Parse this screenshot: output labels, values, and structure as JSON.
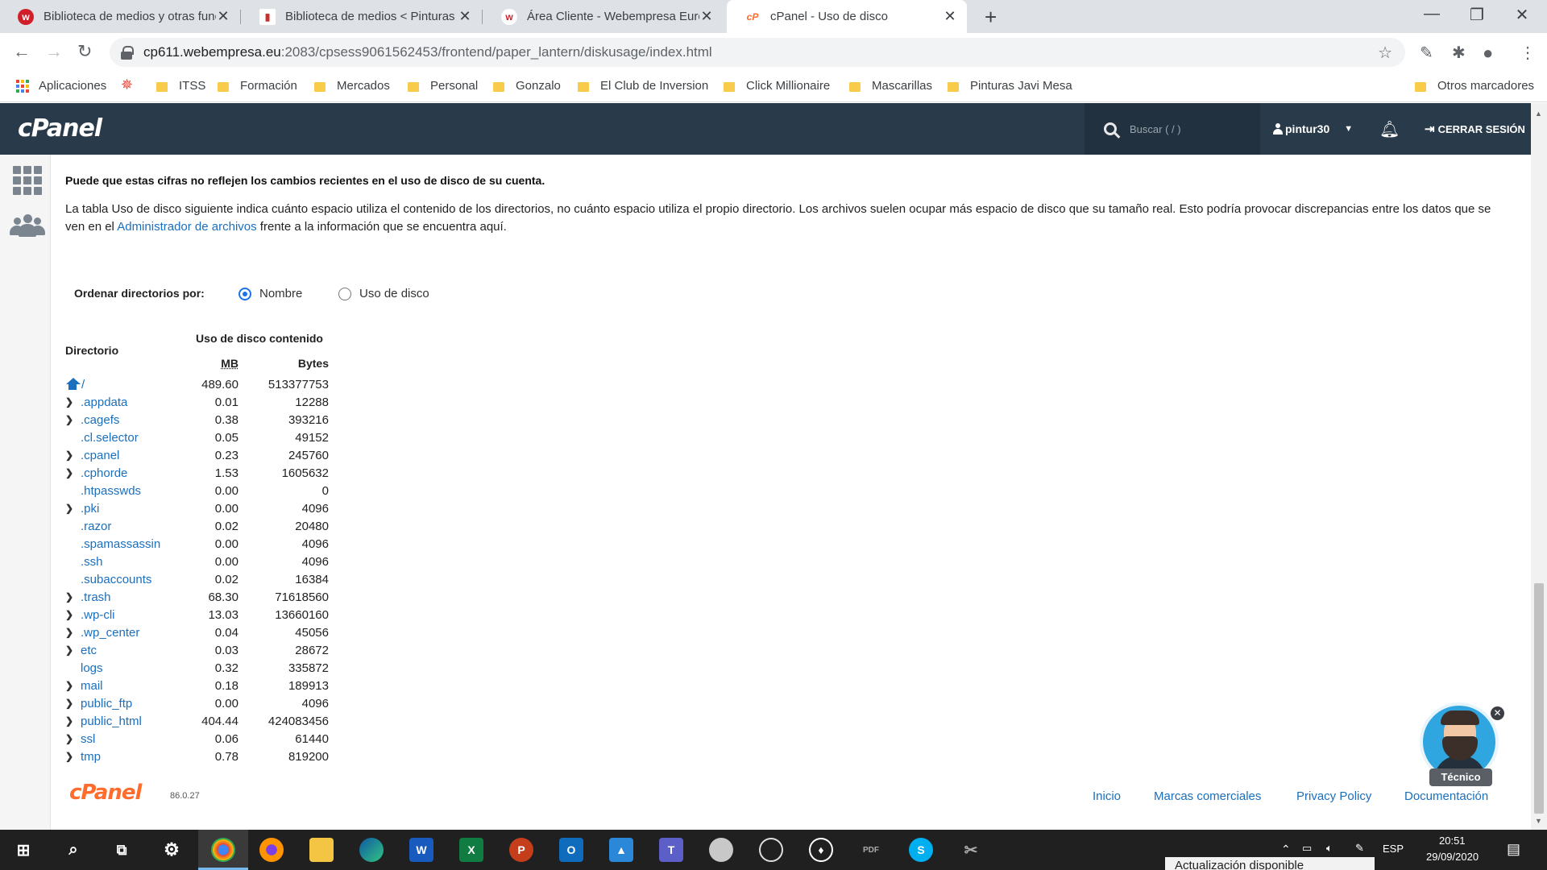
{
  "browser": {
    "tabs": [
      {
        "title": "Biblioteca de medios y otras func",
        "favicon_color": "#d11f2a",
        "favicon_glyph": "w"
      },
      {
        "title": "Biblioteca de medios < Pinturas J",
        "favicon_color": "#c3342f",
        "favicon_glyph": "▮"
      },
      {
        "title": "Área Cliente - Webempresa Euro",
        "favicon_color": "#ffffff",
        "favicon_glyph": "w"
      },
      {
        "title": "cPanel - Uso de disco",
        "favicon_color": "#ff6c2c",
        "favicon_glyph": "cP"
      }
    ],
    "new_tab_icon": "plus-icon",
    "url_host": "cp611.webempresa.eu",
    "url_rest": ":2083/cpsess9061562453/frontend/paper_lantern/diskusage/index.html",
    "bookmarks": [
      "Aplicaciones",
      "ITSS",
      "Formación",
      "Mercados",
      "Personal",
      "Gonzalo",
      "El Club de Inversion",
      "Click Millionaire",
      "Mascarillas",
      "Pinturas Javi Mesa"
    ],
    "other_bookmarks": "Otros marcadores"
  },
  "cpanel": {
    "logo": "cPanel",
    "search_placeholder": "Buscar ( / )",
    "username": "pintur30",
    "logout_label": "CERRAR SESIÓN",
    "brand_color": "#293a4a",
    "accent_color": "#ff6c2c"
  },
  "content": {
    "warning": "Puede que estas cifras no reflejen los cambios recientes en el uso de disco de su cuenta.",
    "explanation_before": "La tabla Uso de disco siguiente indica cuánto espacio utiliza el contenido de los directorios, no cuánto espacio utiliza el propio directorio. Los archivos suelen ocupar más espacio de disco que su tamaño real. Esto podría provocar discrepancias entre los datos que se ven en el ",
    "explanation_link": "Administrador de archivos",
    "explanation_after": " frente a la información que se encuentra aquí.",
    "sort_label": "Ordenar directorios por:",
    "sort_options": [
      {
        "label": "Nombre",
        "selected": true
      },
      {
        "label": "Uso de disco",
        "selected": false
      }
    ],
    "table": {
      "header_dir": "Directorio",
      "header_group": "Uso de disco contenido",
      "header_mb": "MB",
      "header_bytes": "Bytes",
      "rows": [
        {
          "name": "/",
          "mb": "489.60",
          "bytes": "513377753",
          "expandable": false,
          "home": true
        },
        {
          "name": ".appdata",
          "mb": "0.01",
          "bytes": "12288",
          "expandable": true
        },
        {
          "name": ".cagefs",
          "mb": "0.38",
          "bytes": "393216",
          "expandable": true
        },
        {
          "name": ".cl.selector",
          "mb": "0.05",
          "bytes": "49152",
          "expandable": false
        },
        {
          "name": ".cpanel",
          "mb": "0.23",
          "bytes": "245760",
          "expandable": true
        },
        {
          "name": ".cphorde",
          "mb": "1.53",
          "bytes": "1605632",
          "expandable": true
        },
        {
          "name": ".htpasswds",
          "mb": "0.00",
          "bytes": "0",
          "expandable": false
        },
        {
          "name": ".pki",
          "mb": "0.00",
          "bytes": "4096",
          "expandable": true
        },
        {
          "name": ".razor",
          "mb": "0.02",
          "bytes": "20480",
          "expandable": false
        },
        {
          "name": ".spamassassin",
          "mb": "0.00",
          "bytes": "4096",
          "expandable": false
        },
        {
          "name": ".ssh",
          "mb": "0.00",
          "bytes": "4096",
          "expandable": false
        },
        {
          "name": ".subaccounts",
          "mb": "0.02",
          "bytes": "16384",
          "expandable": false
        },
        {
          "name": ".trash",
          "mb": "68.30",
          "bytes": "71618560",
          "expandable": true
        },
        {
          "name": ".wp-cli",
          "mb": "13.03",
          "bytes": "13660160",
          "expandable": true
        },
        {
          "name": ".wp_center",
          "mb": "0.04",
          "bytes": "45056",
          "expandable": true
        },
        {
          "name": "etc",
          "mb": "0.03",
          "bytes": "28672",
          "expandable": true
        },
        {
          "name": "logs",
          "mb": "0.32",
          "bytes": "335872",
          "expandable": false
        },
        {
          "name": "mail",
          "mb": "0.18",
          "bytes": "189913",
          "expandable": true
        },
        {
          "name": "public_ftp",
          "mb": "0.00",
          "bytes": "4096",
          "expandable": true
        },
        {
          "name": "public_html",
          "mb": "404.44",
          "bytes": "424083456",
          "expandable": true
        },
        {
          "name": "ssl",
          "mb": "0.06",
          "bytes": "61440",
          "expandable": true
        },
        {
          "name": "tmp",
          "mb": "0.78",
          "bytes": "819200",
          "expandable": true
        }
      ]
    }
  },
  "footer": {
    "logo": "cPanel",
    "version": "86.0.27",
    "links": [
      "Inicio",
      "Marcas comerciales",
      "Privacy Policy",
      "Documentación"
    ]
  },
  "chat": {
    "label": "Técnico"
  },
  "taskbar": {
    "language": "ESP",
    "time": "20:51",
    "date": "29/09/2020",
    "toast": "Actualización disponible"
  },
  "link_color": "#1a6fbf"
}
